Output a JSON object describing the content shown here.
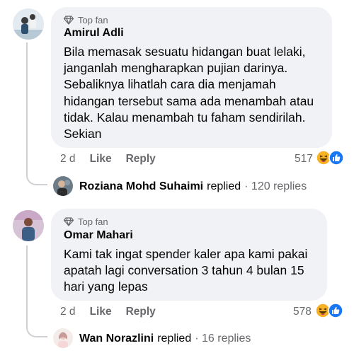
{
  "comments": [
    {
      "badge": "Top fan",
      "name": "Amirul Adli",
      "lines": [
        "Bila memasak sesuatu hidangan buat lelaki,",
        "janganlah mengharapkan pujian darinya.",
        "Sebaliknya lihatlah cara dia menjamah",
        "hidangan tersebut sama ada menambah atau",
        "tidak. Kalau menambah tu faham sendirilah.",
        "Sekian"
      ],
      "time": "2 d",
      "like": "Like",
      "reply": "Reply",
      "reaction_count": "517",
      "reactions": [
        "haha-icon",
        "like-icon"
      ],
      "replied_by": "Roziana Mohd Suhaimi",
      "replied_text": "replied",
      "replies": "· 120 replies"
    },
    {
      "badge": "Top fan",
      "name": "Omar Mahari",
      "lines": [
        "Kami tak ingat spender kaler apa kami pakai",
        "apatah lagi conversation 3 tahun 4 bulan 15",
        "hari yang lepas"
      ],
      "time": "2 d",
      "like": "Like",
      "reply": "Reply",
      "reaction_count": "578",
      "reactions": [
        "haha-icon",
        "like-icon"
      ],
      "replied_by": "Wan Norazlini",
      "replied_text": "replied",
      "replies": "· 16 replies"
    }
  ],
  "colors": {
    "bubble": "#f0f2f5",
    "meta": "#65676b",
    "like_blue": "#1877f2",
    "haha_yellow": "#f7b125"
  }
}
